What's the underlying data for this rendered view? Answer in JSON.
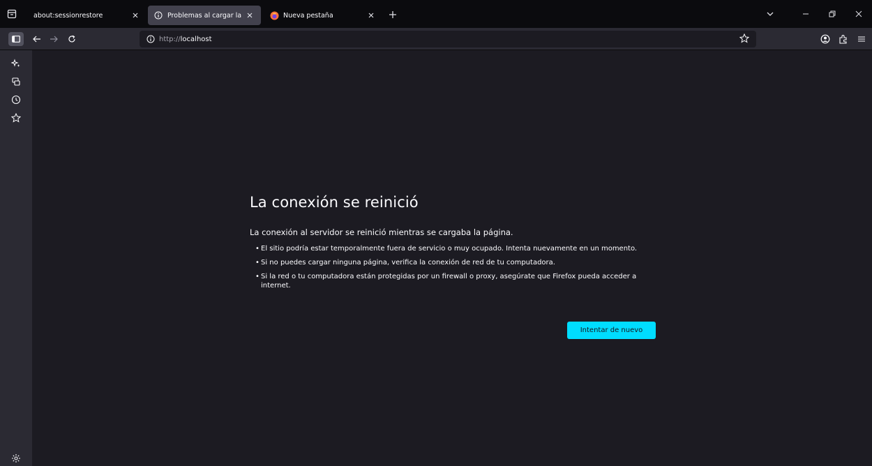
{
  "tabs": [
    {
      "label": "about:sessionrestore",
      "icon": "restore-icon",
      "active": false
    },
    {
      "label": "Problemas al cargar la página",
      "icon": "info-icon",
      "active": true
    },
    {
      "label": "Nueva pestaña",
      "icon": "firefox-icon",
      "active": false
    }
  ],
  "urlbar": {
    "scheme": "http://",
    "host": "localhost"
  },
  "error_page": {
    "title": "La conexión se reinició",
    "intro": "La conexión al servidor se reinició mientras se cargaba la página.",
    "bullets": [
      "El sitio podría estar temporalmente fuera de servicio o muy ocupado. Intenta nuevamente en un momento.",
      "Si no puedes cargar ninguna página, verifica la conexión de red de tu computadora.",
      "Si la red o tu computadora están protegidas por un firewall o proxy, asegúrate que Firefox pueda acceder a internet."
    ],
    "retry_label": "Intentar de nuevo"
  },
  "colors": {
    "accent": "#00ddff",
    "background": "#1c1b22",
    "toolbar": "#2b2a33",
    "tabstrip": "#0b0b0e"
  }
}
